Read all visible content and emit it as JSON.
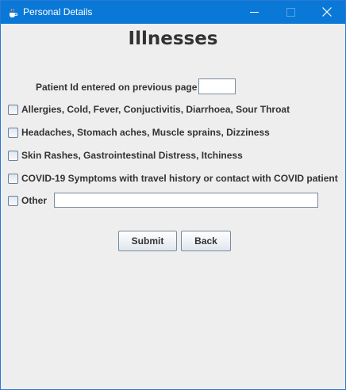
{
  "window": {
    "title": "Personal Details",
    "title_icon": "java-coffee-cup-icon",
    "controls": [
      "minimize-icon",
      "maximize-icon",
      "close-icon"
    ]
  },
  "form": {
    "heading": "Illnesses",
    "patient_id_label": "Patient Id entered on previous page",
    "patient_id_value": "",
    "options": [
      {
        "label": "Allergies, Cold, Fever, Conjuctivitis, Diarrhoea, Sour Throat",
        "checked": false
      },
      {
        "label": "Headaches, Stomach aches, Muscle sprains, Dizziness",
        "checked": false
      },
      {
        "label": "Skin Rashes, Gastrointestinal Distress, Itchiness",
        "checked": false
      },
      {
        "label": "COVID-19 Symptoms with travel history or contact with COVID patient",
        "checked": false
      }
    ],
    "other_label": "Other",
    "other_checked": false,
    "other_value": "",
    "submit_label": "Submit",
    "back_label": "Back"
  },
  "colors": {
    "titlebar": "#0a78d7",
    "background": "#eeeeee",
    "text": "#333333"
  }
}
